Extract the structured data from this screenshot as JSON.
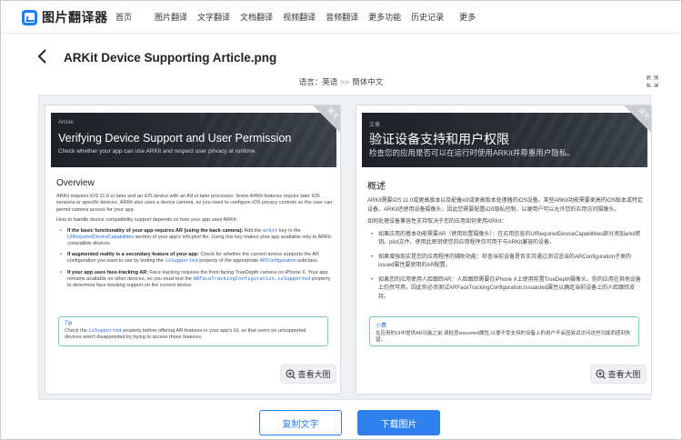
{
  "app": {
    "name": "图片翻译器"
  },
  "nav": [
    "首页",
    "图片翻译",
    "文字翻译",
    "文档翻译",
    "视频翻译",
    "音频翻译",
    "更多功能",
    "历史记录",
    "更多"
  ],
  "document": {
    "title": "ARKit Device Supporting Article.png"
  },
  "language": {
    "label": "语言：",
    "source": "英语",
    "arrow": ">>",
    "target": "簡体中文"
  },
  "original": {
    "corner_label": "原文",
    "banner_tag": "Article",
    "banner_title": "Verifying Device Support and User Permission",
    "banner_subtitle": "Check whether your app can use ARKit and respect user privacy at runtime.",
    "section_title": "Overview",
    "p1": "ARKit requires iOS 11.0 or later and an iOS device with an A9 or later processor. Some ARKit features require later iOS versions or specific devices. ARKit also uses a device camera, so you need to configure iOS privacy controls so the user can permit camera access for your app.",
    "p2": "How to handle device compatibility support depends on how your app uses ARKit:",
    "items": [
      {
        "bold": "If the basic functionality of your app requires AR (using the back camera):",
        "pre": " Add the ",
        "code": "arkit",
        "post": " key in the ",
        "link": "UIRequiredDeviceCapabilities",
        "rest": " section of your app's Info.plist file. Using this key makes your app available only to ARKit-compatible devices."
      },
      {
        "bold": "If augmented reality is a secondary feature of your app:",
        "pre": " Check for whether the current device supports the AR configuration you want to use by testing the ",
        "code": "isSupported",
        "post": " property of the appropriate ",
        "link": "ARConfiguration",
        "rest": " subclass."
      },
      {
        "bold": "If your app uses face-tracking AR:",
        "pre": " Face tracking requires the front-facing TrueDepth camera on iPhone X. Your app remains available on other devices, so you must test the ",
        "code": "ARFaceTrackingConfiguration.isSupported",
        "post": " property to determine face-tracking support on the current device.",
        "link": "",
        "rest": ""
      }
    ],
    "tip_title": "Tip",
    "tip_text_pre": "Check the ",
    "tip_code": "isSupported",
    "tip_text_post": " property before offering AR features in your app's UI, so that users on unsupported devices aren't disappointed by trying to access those features.",
    "view_button": "查看大图"
  },
  "translated": {
    "corner_label": "译文",
    "banner_tag": "文章",
    "banner_title": "验证设备支持和用户权限",
    "banner_subtitle": "检查您的应用是否可以在运行时使用ARKit并尊重用户隐私。",
    "section_title": "概述",
    "p1": "ARKit需要iOS 11.0或更高版本以及配备A9或更高版本处理器的iOS设备。某些ARKit功能需要更高的iOS版本或特定设备。ARKit还使用设备摄像头，因此您需要配置iOS隐私控制，以便用户可以允许您的应用访问摄像头。",
    "p2": "如何处理设备兼容性支持取决于您的应用如何使用ARKit：",
    "items": [
      "如果应用的基本功能需要AR（使用后置摄像头）：在应用信息的UIRequiredDeviceCapabilities部分添加arkit密钥。plist文件。使用此密钥使您的应用程序仅可用于与ARKit兼容的设备。",
      "如果增强现实是您的应用程序的辅助功能：检查当前设备是否支持通过测试适当的ARConfiguration子类的issued属性要使用的AR配置。",
      "如果您的应用使用人脸跟踪AR：人脸跟踪需要在iPhone X上使用前置TrueDepth摄像头。你的应用在其他设备上仍然可用，因此你必须测试ARFaceTrackingConfiguration.Issuarded属性以确定当前设备上的人脸跟踪支持。"
    ],
    "tip_title": "小费",
    "tip_text": "在应用的UI中提供AR功能之前,请检查issuorted属性,以便不受支持的设备上的用户不会因尝试访问这些功能而感到失望。",
    "view_button": "查看大图"
  },
  "actions": {
    "copy": "复制文字",
    "download": "下载图片"
  },
  "colors": {
    "accent": "#2f80ed",
    "tip_border": "#7ec8b9",
    "banner": "#1e2227"
  },
  "icons": {
    "back": "back-arrow-icon",
    "expand": "expand-icon",
    "zoom": "zoom-in-icon",
    "logo": "image-translate-logo-icon"
  }
}
